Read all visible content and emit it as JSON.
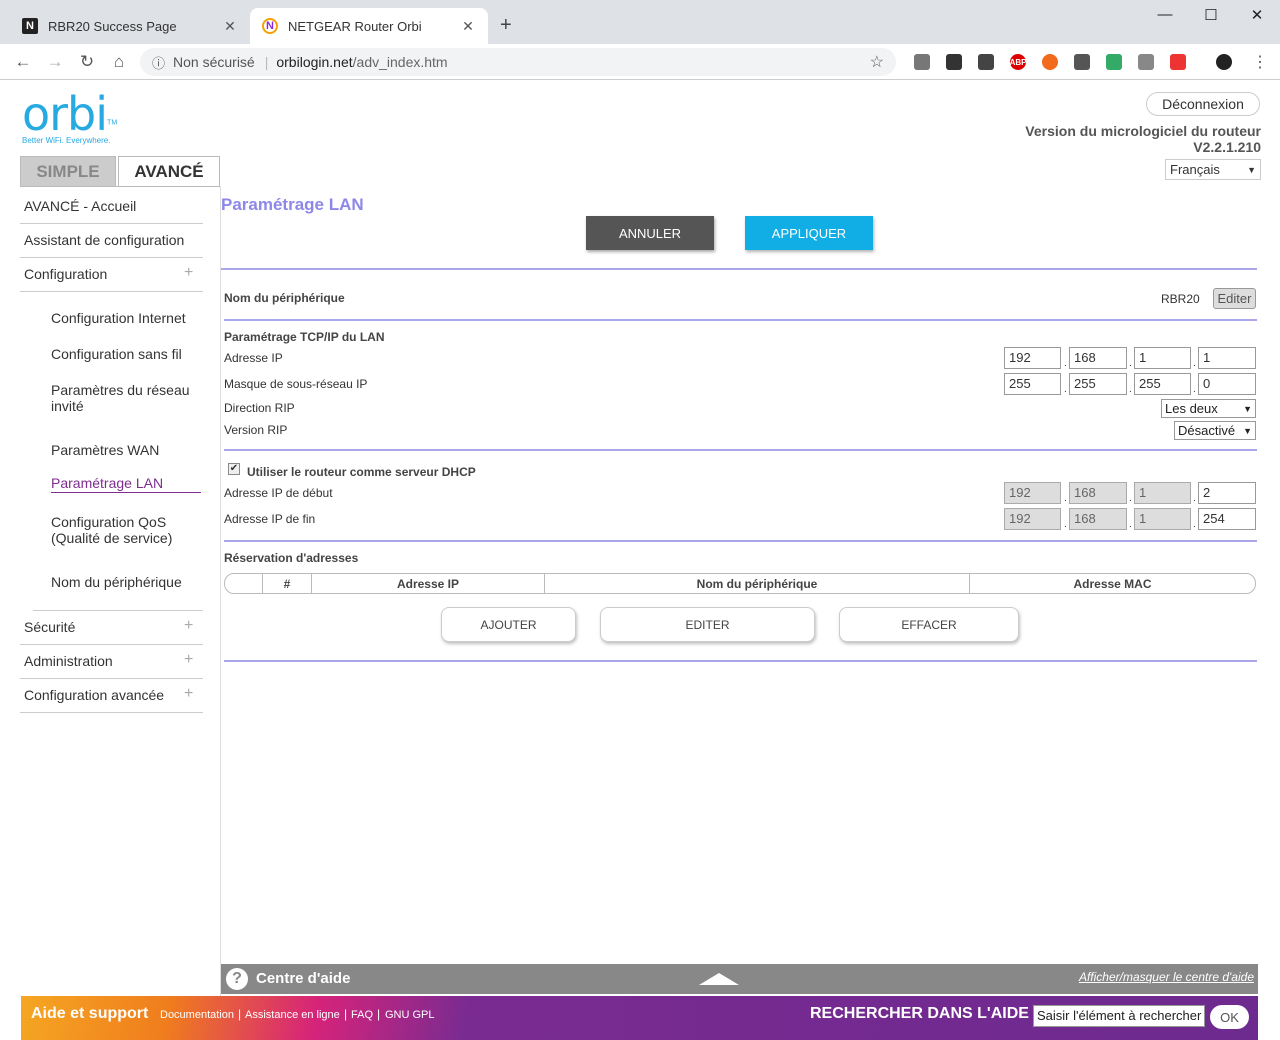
{
  "browser": {
    "tabs": [
      {
        "title": "RBR20 Success Page",
        "icon": "notion-n-icon"
      },
      {
        "title": "NETGEAR Router Orbi",
        "icon": "netgear-icon"
      }
    ],
    "url": {
      "security": "Non sécurisé",
      "host": "orbilogin.net",
      "path": "/adv_index.htm"
    }
  },
  "header": {
    "logo_word": "orbi",
    "logo_tm": "TM",
    "logo_tagline": "Better WiFi. Everywhere.",
    "logout": "Déconnexion",
    "fw_label": "Version du micrologiciel du routeur",
    "fw_version": "V2.2.1.210",
    "language": "Français",
    "mode_tabs": {
      "simple": "SIMPLE",
      "avance": "AVANCÉ"
    }
  },
  "sidebar": {
    "home": "AVANCÉ - Accueil",
    "wizard": "Assistant de configuration",
    "config": "Configuration",
    "sub": [
      "Configuration Internet",
      "Configuration sans fil",
      "Paramètres du réseau invité",
      "Paramètres WAN",
      "Paramétrage LAN",
      "Configuration QoS (Qualité de service)",
      "Nom du périphérique"
    ],
    "security": "Sécurité",
    "admin": "Administration",
    "advanced": "Configuration avancée"
  },
  "main": {
    "title": "Paramétrage LAN",
    "cancel": "ANNULER",
    "apply": "APPLIQUER",
    "device_name_label": "Nom du périphérique",
    "device_name_value": "RBR20",
    "edit_small": "Editer",
    "tcpip_title": "Paramétrage TCP/IP du LAN",
    "ip_label": "Adresse IP",
    "ip": [
      "192",
      "168",
      "1",
      "1"
    ],
    "mask_label": "Masque de sous-réseau IP",
    "mask": [
      "255",
      "255",
      "255",
      "0"
    ],
    "rip_dir_label": "Direction RIP",
    "rip_dir_value": "Les deux",
    "rip_ver_label": "Version RIP",
    "rip_ver_value": "Désactivé",
    "dhcp_label": "Utiliser le routeur comme serveur DHCP",
    "dhcp_checked": true,
    "start_label": "Adresse IP de début",
    "start_ip": [
      "192",
      "168",
      "1",
      "2"
    ],
    "end_label": "Adresse IP de fin",
    "end_ip": [
      "192",
      "168",
      "1",
      "254"
    ],
    "res_title": "Réservation d'adresses",
    "res_cols": [
      "",
      "#",
      "Adresse IP",
      "Nom du périphérique",
      "Adresse MAC"
    ],
    "btn_add": "AJOUTER",
    "btn_edit": "EDITER",
    "btn_delete": "EFFACER"
  },
  "help": {
    "title": "Centre d'aide",
    "toggle": "Afficher/masquer le centre d'aide"
  },
  "footer": {
    "title": "Aide et support",
    "links": [
      "Documentation",
      "Assistance en ligne",
      "FAQ",
      "GNU GPL"
    ],
    "search_label": "RECHERCHER DANS L'AIDE",
    "search_value": "Saisir l'élément à rechercher",
    "ok": "OK"
  }
}
